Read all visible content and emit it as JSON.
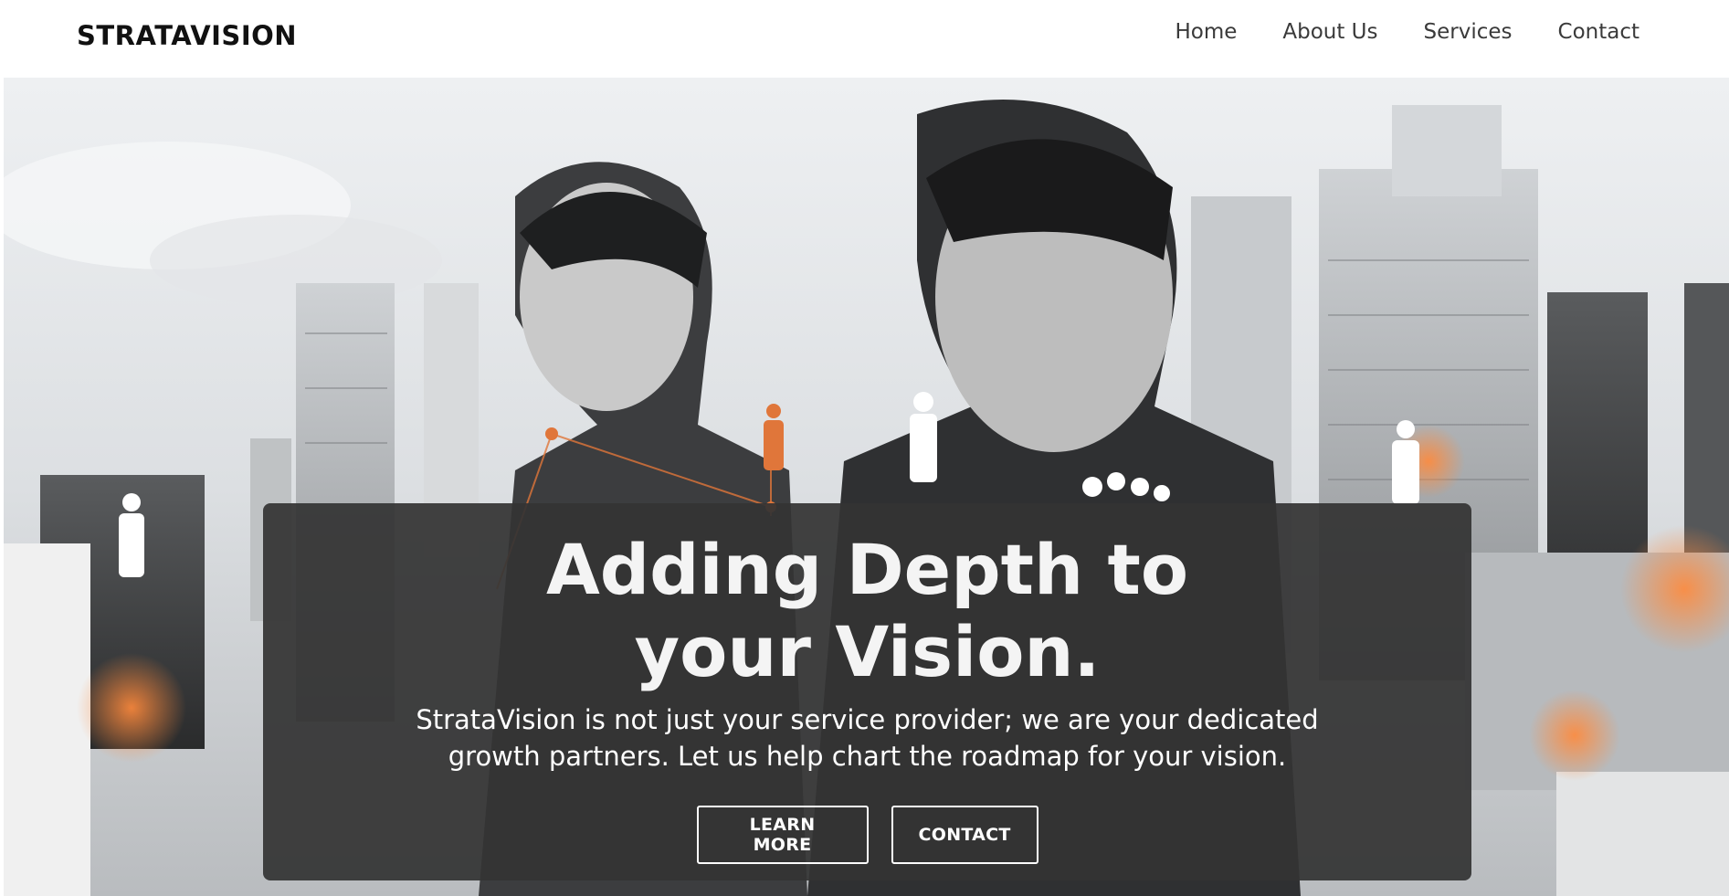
{
  "brand": {
    "name": "STRATAVISION"
  },
  "nav": {
    "items": [
      {
        "label": "Home"
      },
      {
        "label": "About Us"
      },
      {
        "label": "Services"
      },
      {
        "label": "Contact"
      }
    ]
  },
  "hero": {
    "title": "Adding Depth to your Vision.",
    "description": "StrataVision is not just your service provider; we are your dedicated growth partners. Let us help chart the roadmap for your vision.",
    "buttons": {
      "learn_more": "LEARN MORE",
      "contact": "CONTACT"
    }
  },
  "colors": {
    "overlay": "#343434",
    "accent": "#e0763a",
    "text_light": "#ffffff",
    "nav_text": "#3a3a3a"
  }
}
